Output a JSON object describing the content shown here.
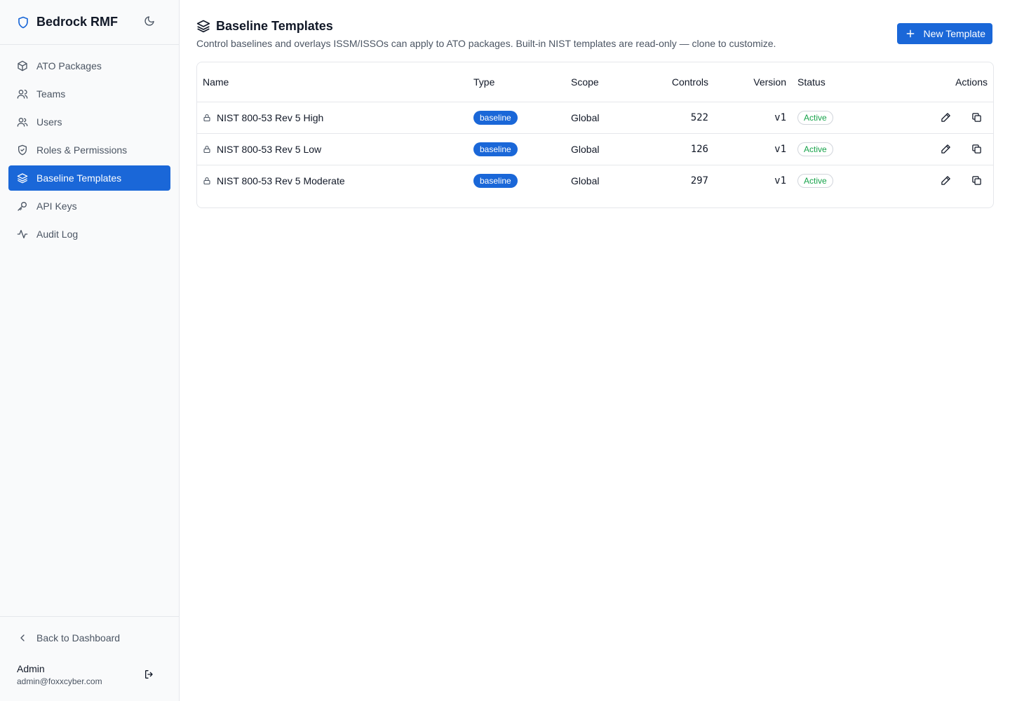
{
  "app": {
    "name": "Bedrock RMF"
  },
  "sidebar": {
    "items": [
      {
        "label": "ATO Packages",
        "icon": "package-icon"
      },
      {
        "label": "Teams",
        "icon": "teams-icon"
      },
      {
        "label": "Users",
        "icon": "users-icon"
      },
      {
        "label": "Roles & Permissions",
        "icon": "shield-check-icon"
      },
      {
        "label": "Baseline Templates",
        "icon": "layers-icon",
        "active": true
      },
      {
        "label": "API Keys",
        "icon": "key-icon"
      },
      {
        "label": "Audit Log",
        "icon": "activity-icon"
      }
    ],
    "back_label": "Back to Dashboard",
    "user": {
      "name": "Admin",
      "email": "admin@foxxcyber.com"
    }
  },
  "page": {
    "title": "Baseline Templates",
    "subtitle": "Control baselines and overlays ISSM/ISSOs can apply to ATO packages. Built-in NIST templates are read-only — clone to customize.",
    "new_button": "New Template"
  },
  "table": {
    "columns": {
      "name": "Name",
      "type": "Type",
      "scope": "Scope",
      "controls": "Controls",
      "version": "Version",
      "status": "Status",
      "actions": "Actions"
    },
    "rows": [
      {
        "name": "NIST 800-53 Rev 5 High",
        "type": "baseline",
        "scope": "Global",
        "controls": "522",
        "version": "v1",
        "status": "Active"
      },
      {
        "name": "NIST 800-53 Rev 5 Low",
        "type": "baseline",
        "scope": "Global",
        "controls": "126",
        "version": "v1",
        "status": "Active"
      },
      {
        "name": "NIST 800-53 Rev 5 Moderate",
        "type": "baseline",
        "scope": "Global",
        "controls": "297",
        "version": "v1",
        "status": "Active"
      }
    ]
  },
  "colors": {
    "accent": "#1a67d8",
    "status_active": "#16a34a"
  }
}
